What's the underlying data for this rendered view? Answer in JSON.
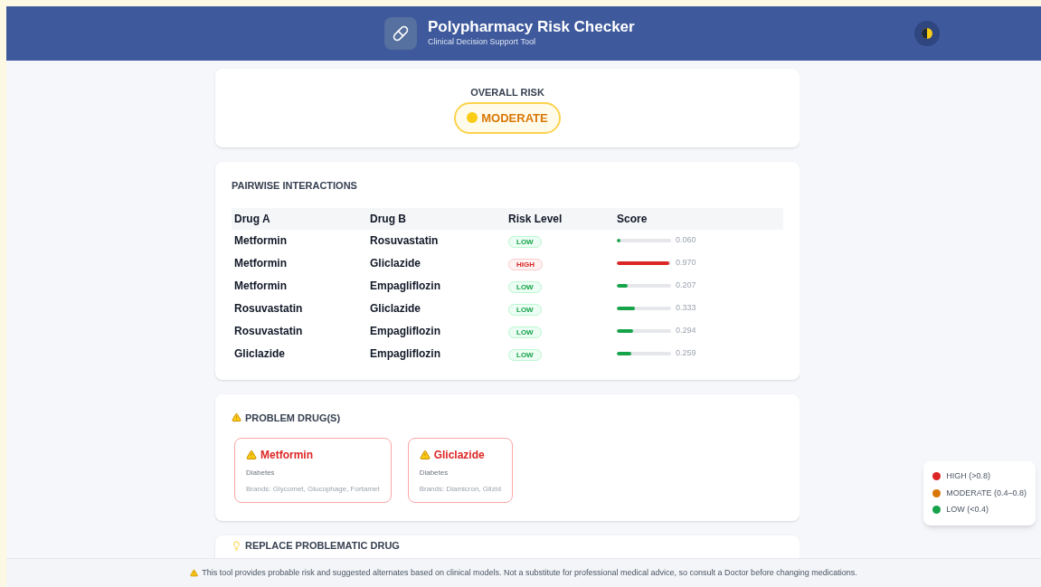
{
  "header": {
    "title": "Polypharmacy Risk Checker",
    "subtitle": "Clinical Decision Support Tool"
  },
  "overall": {
    "label": "OVERALL RISK",
    "value": "MODERATE",
    "kind": "moderate"
  },
  "pairwise": {
    "title": "PAIRWISE INTERACTIONS",
    "columns": [
      "Drug A",
      "Drug B",
      "Risk Level",
      "Score"
    ],
    "rows": [
      {
        "drug_a": "Metformin",
        "drug_b": "Rosuvastatin",
        "risk_label": "LOW",
        "kind": "low",
        "level": 0.06,
        "score": "0.060"
      },
      {
        "drug_a": "Metformin",
        "drug_b": "Gliclazide",
        "risk_label": "HIGH",
        "kind": "high",
        "level": 0.97,
        "score": "0.970"
      },
      {
        "drug_a": "Metformin",
        "drug_b": "Empagliflozin",
        "risk_label": "LOW",
        "kind": "low",
        "level": 0.207,
        "score": "0.207"
      },
      {
        "drug_a": "Rosuvastatin",
        "drug_b": "Gliclazide",
        "risk_label": "LOW",
        "kind": "low",
        "level": 0.333,
        "score": "0.333"
      },
      {
        "drug_a": "Rosuvastatin",
        "drug_b": "Empagliflozin",
        "risk_label": "LOW",
        "kind": "low",
        "level": 0.294,
        "score": "0.294"
      },
      {
        "drug_a": "Gliclazide",
        "drug_b": "Empagliflozin",
        "risk_label": "LOW",
        "kind": "low",
        "level": 0.259,
        "score": "0.259"
      }
    ]
  },
  "problem_drugs": {
    "title": "PROBLEM DRUG(S)",
    "items": [
      {
        "name": "Metformin",
        "category": "Diabetes",
        "brands": "Brands: Glycomet, Glucophage, Fortamet"
      },
      {
        "name": "Gliclazide",
        "category": "Diabetes",
        "brands": "Brands: Diamicron, Glizid"
      }
    ]
  },
  "replace": {
    "title": "REPLACE PROBLEMATIC DRUG"
  },
  "legend": [
    {
      "label": "HIGH (>0.8)",
      "color": "#dc2626"
    },
    {
      "label": "MODERATE (0.4–0.8)",
      "color": "#d97706"
    },
    {
      "label": "LOW (<0.4)",
      "color": "#16a34a"
    }
  ],
  "footer": {
    "text": "This tool provides probable risk and suggested alternates based on clinical models. Not a substitute for professional medical advice, so consult a Doctor before changing medications."
  }
}
